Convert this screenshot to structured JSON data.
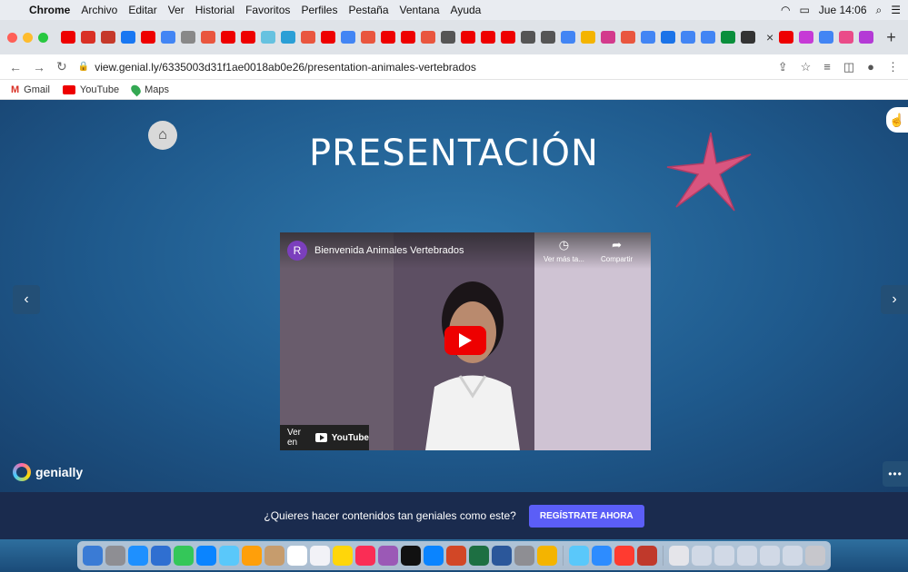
{
  "menubar": {
    "app": "Chrome",
    "items": [
      "Archivo",
      "Editar",
      "Ver",
      "Historial",
      "Favoritos",
      "Perfiles",
      "Pestaña",
      "Ventana",
      "Ayuda"
    ],
    "datetime": "Jue 14:06"
  },
  "browser": {
    "url": "view.genial.ly/6335003d31f1ae0018ab0e26/presentation-animales-vertebrados",
    "bookmarks": [
      "Gmail",
      "YouTube",
      "Maps"
    ]
  },
  "slide": {
    "title": "PRESENTACIÓN",
    "prev_label": "‹",
    "next_label": "›",
    "more_label": "•••",
    "brand": "genially"
  },
  "video": {
    "channel_initial": "R",
    "title": "Bienvenida Animales Vertebrados",
    "watch_later": "Ver más ta...",
    "share": "Compartir",
    "watch_on": "Ver en",
    "yt_wordmark": "YouTube"
  },
  "footer": {
    "prompt": "¿Quieres hacer contenidos tan geniales como este?",
    "cta": "REGÍSTRATE AHORA"
  },
  "colors": {
    "stage_bg": "#1f5a8d",
    "footer_bg": "#1a2b4e",
    "cta_bg": "#5b5ef7",
    "starfish": "#d9557f"
  }
}
